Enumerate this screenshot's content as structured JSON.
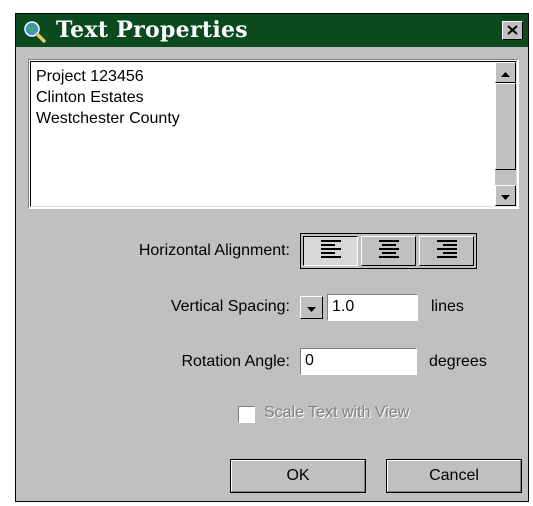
{
  "window": {
    "title": "Text Properties",
    "title_bar_color": "#0a4a1e",
    "icons": {
      "app": "magnifier-globe-icon",
      "close": "close-icon"
    }
  },
  "text_area": {
    "lines": [
      "Project 123456",
      "Clinton Estates",
      "Westchester County"
    ]
  },
  "horizontal_alignment": {
    "label": "Horizontal Alignment:",
    "options": [
      "align-left-icon",
      "align-center-icon",
      "align-right-icon"
    ],
    "selected": "align-left-icon"
  },
  "vertical_spacing": {
    "label": "Vertical Spacing:",
    "value": "1.0",
    "unit": "lines"
  },
  "rotation_angle": {
    "label": "Rotation Angle:",
    "value": "0",
    "unit": "degrees"
  },
  "scale_text": {
    "label": "Scale Text with View",
    "checked": false,
    "enabled": false
  },
  "buttons": {
    "ok": "OK",
    "cancel": "Cancel"
  }
}
